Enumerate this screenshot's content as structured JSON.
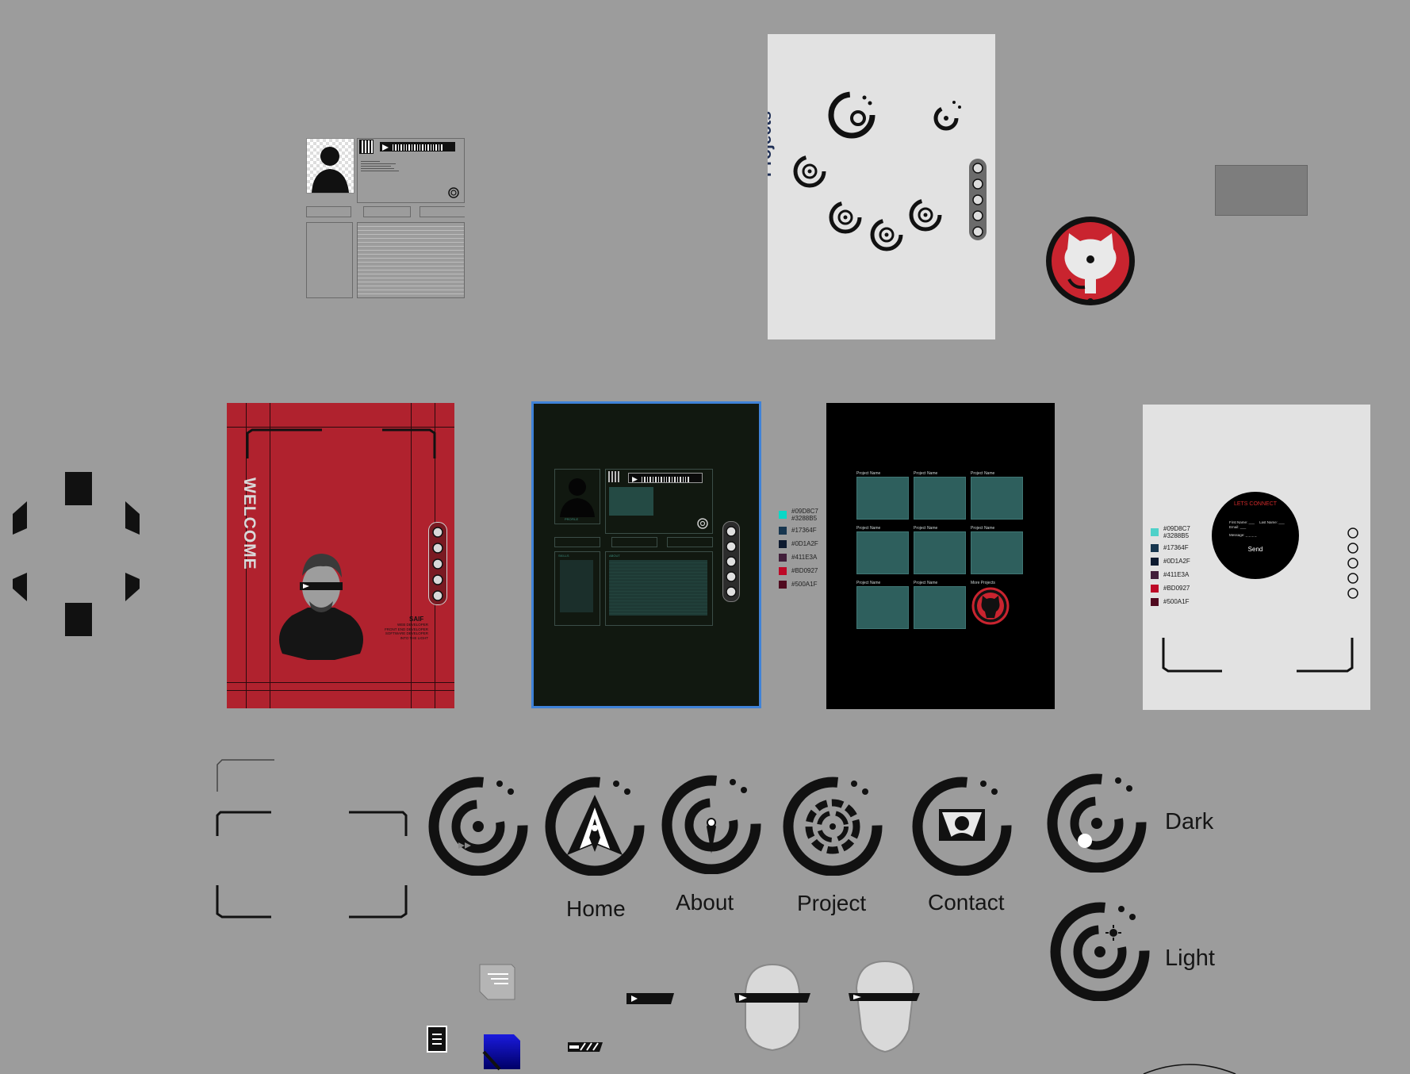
{
  "canvas": {
    "background": "#9c9c9c"
  },
  "projects_frame": {
    "title": "Projects"
  },
  "welcome_frame": {
    "heading": "WELCOME",
    "name": "SAIF",
    "roles": [
      "WEB DEVELOPER",
      "FRONT END DEVELOPER",
      "SOFTWARE DEVELOPER",
      "INTO THE LIGHT"
    ],
    "background": "#b0222e"
  },
  "about_frame": {
    "profile_label": "PROFILE",
    "skills_label": "SKILLS",
    "about_label": "ABOUT"
  },
  "palette": [
    {
      "hex": "#09D8C7\n#3288B5",
      "label_a": "#09D8C7",
      "label_b": "#3288B5",
      "color": "#09d8c7"
    },
    {
      "label_a": "#17364F",
      "color": "#17364f"
    },
    {
      "label_a": "#0D1A2F",
      "color": "#0d1a2f"
    },
    {
      "label_a": "#411E3A",
      "color": "#411e3a"
    },
    {
      "label_a": "#BD0927",
      "color": "#bd0927"
    },
    {
      "label_a": "#500A1F",
      "color": "#500a1f"
    }
  ],
  "projects_grid": {
    "card_label": "Project Name",
    "more_label": "More Projects"
  },
  "contact_frame": {
    "title": "LETS CONNECT",
    "first_name": "First Name: ___",
    "last_name": "Last Name: ___",
    "email": "Email: ___",
    "message": "Message: _ _ _ _",
    "send": "Send"
  },
  "nav_labels": {
    "home": "Home",
    "about": "About",
    "project": "Project",
    "contact": "Contact"
  },
  "theme_labels": {
    "dark": "Dark",
    "light": "Light"
  },
  "icons": [
    "projects-nav-icon",
    "home-nav-icon",
    "about-nav-icon",
    "project-nav-icon",
    "contact-nav-icon",
    "dark-mode-icon",
    "light-mode-icon",
    "github-icon",
    "document-icon",
    "menu-lines-icon",
    "play-bar-icon",
    "visor-head-icon"
  ]
}
